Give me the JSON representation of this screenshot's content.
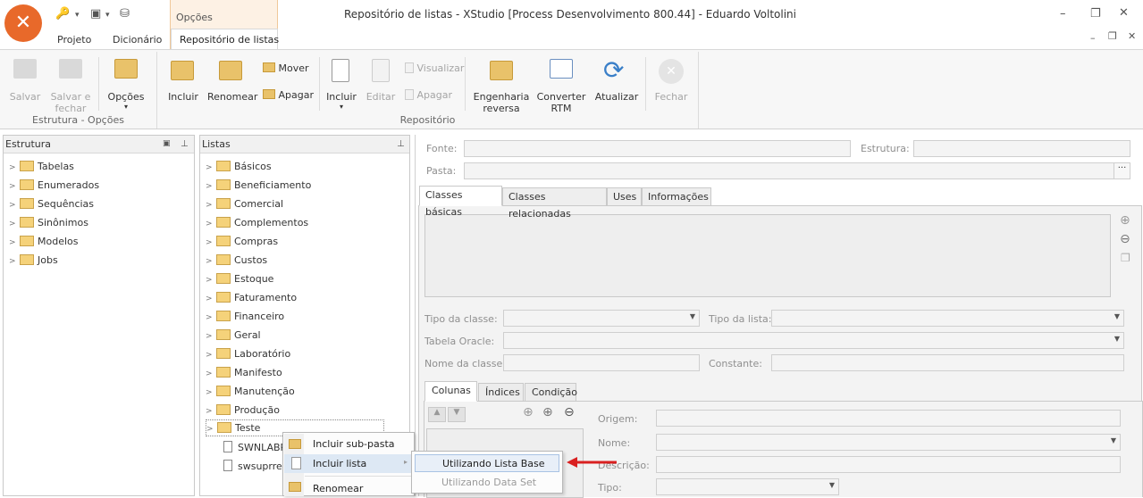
{
  "window": {
    "title": "Repositório de listas - XStudio [Process Desenvolvimento 800.44] - Eduardo Voltolini"
  },
  "tabs": {
    "projeto": "Projeto",
    "dicionario": "Dicionário",
    "context_group": "Opções",
    "active": "Repositório de listas"
  },
  "ribbon": {
    "salvar": "Salvar",
    "salvar_fechar": "Salvar e fechar",
    "opcoes": "Opções",
    "group1": "Estrutura - Opções",
    "incluir": "Incluir",
    "renomear": "Renomear",
    "mover": "Mover",
    "apagar": "Apagar",
    "incluir2": "Incluir",
    "editar": "Editar",
    "visualizar": "Visualizar",
    "apagar2": "Apagar",
    "engenharia": "Engenharia reversa",
    "converter": "Converter RTM",
    "atualizar": "Atualizar",
    "fechar": "Fechar",
    "group2": "Repositório"
  },
  "estrutura": {
    "title": "Estrutura",
    "items": [
      "Tabelas",
      "Enumerados",
      "Sequências",
      "Sinônimos",
      "Modelos",
      "Jobs"
    ]
  },
  "listas": {
    "title": "Listas",
    "folders": [
      "Básicos",
      "Beneficiamento",
      "Comercial",
      "Complementos",
      "Compras",
      "Custos",
      "Estoque",
      "Faturamento",
      "Financeiro",
      "Geral",
      "Laboratório",
      "Manifesto",
      "Manutenção",
      "Produção",
      "Teste"
    ],
    "files": [
      "SWNLABPA",
      "swsuprren"
    ]
  },
  "form": {
    "fonte": "Fonte:",
    "estrutura": "Estrutura:",
    "pasta": "Pasta:",
    "tabs": [
      "Classes básicas",
      "Classes relacionadas",
      "Uses",
      "Informações"
    ],
    "tipo_classe": "Tipo da classe:",
    "tipo_lista": "Tipo da lista:",
    "tabela_oracle": "Tabela Oracle:",
    "nome_classe": "Nome da classe:",
    "constante": "Constante:",
    "subtabs": [
      "Colunas",
      "Índices",
      "Condição"
    ],
    "origem": "Origem:",
    "nome": "Nome:",
    "descricao": "Descrição:",
    "tipo": "Tipo:"
  },
  "context_menu": {
    "items": [
      "Incluir sub-pasta",
      "Incluir lista",
      "Renomear"
    ],
    "submenu": [
      "Utilizando Lista Base",
      "Utilizando Data Set"
    ]
  }
}
